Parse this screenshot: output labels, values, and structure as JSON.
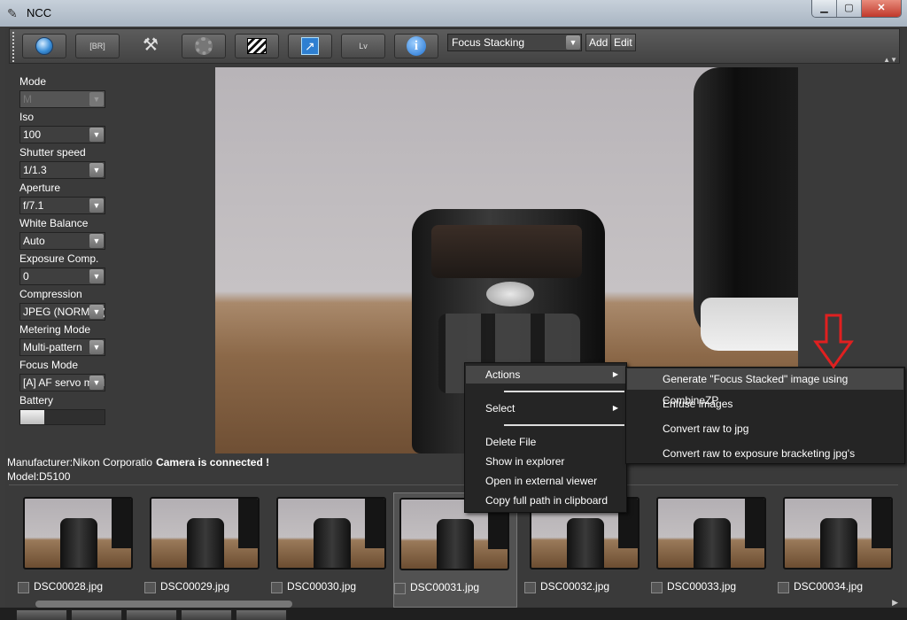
{
  "window": {
    "title": "NCC"
  },
  "toolbar": {
    "br_label": "[BR]",
    "lv_label": "Lv",
    "mode_select": "Focus Stacking",
    "add_label": "Add",
    "edit_label": "Edit"
  },
  "settings": [
    {
      "label": "Mode",
      "value": "M",
      "disabled": true
    },
    {
      "label": "Iso",
      "value": "100"
    },
    {
      "label": "Shutter speed",
      "value": "1/1.3"
    },
    {
      "label": "Aperture",
      "value": "f/7.1"
    },
    {
      "label": "White Balance",
      "value": "Auto"
    },
    {
      "label": "Exposure Comp.",
      "value": "0"
    },
    {
      "label": "Compression",
      "value": "JPEG (NORMAL)"
    },
    {
      "label": "Metering Mode",
      "value": "Multi-pattern"
    },
    {
      "label": "Focus Mode",
      "value": "[A] AF servo mode"
    }
  ],
  "battery": {
    "label": "Battery",
    "level": 0.28
  },
  "status": {
    "manufacturer": "Manufacturer:Nikon Corporatio",
    "connection": "Camera is connected !",
    "model": "Model:D5100"
  },
  "thumbnails": [
    {
      "name": "DSC00028.jpg"
    },
    {
      "name": "DSC00029.jpg"
    },
    {
      "name": "DSC00030.jpg"
    },
    {
      "name": "DSC00031.jpg",
      "selected": true
    },
    {
      "name": "DSC00032.jpg"
    },
    {
      "name": "DSC00033.jpg"
    },
    {
      "name": "DSC00034.jpg"
    }
  ],
  "context_menu": {
    "actions": "Actions",
    "select": "Select",
    "delete": "Delete File",
    "explorer": "Show in explorer",
    "external": "Open in external viewer",
    "copy_path": "Copy full path in clipboard"
  },
  "actions_submenu": {
    "focus_stack": "Generate \"Focus Stacked\" image using CombineZP",
    "enfuse": "Enfuse images",
    "raw_jpg": "Convert raw to jpg",
    "raw_bracket": "Convert raw to exposure bracketing jpg's"
  },
  "colors": {
    "highlight_arrow": "#e02020",
    "menu_bg": "#252525"
  }
}
